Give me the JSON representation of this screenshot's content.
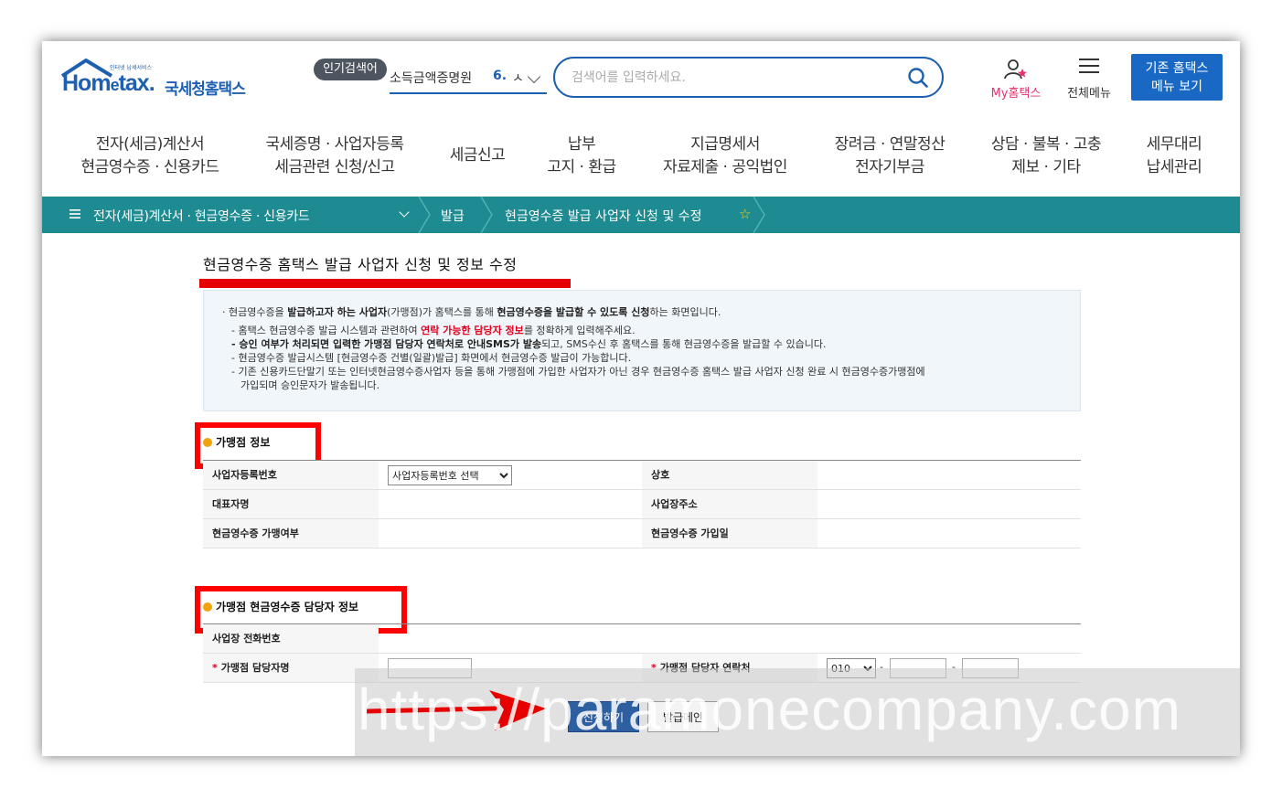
{
  "header": {
    "logo_small": "인터넷 납세서비스",
    "logo_brand": "Hom",
    "logo_brand_e": "e",
    "logo_brand_tail": "tax.",
    "logo_kname": "국세청홈택스",
    "popular_badge": "인기검색어",
    "popular_term": "소득금액증명원",
    "popular_rank": "6.",
    "popular_rank_text": "ㅅ",
    "search_placeholder": "검색어를 입력하세요.",
    "my_label": "My홈택스",
    "allmenu_label": "전체메뉴",
    "oldmenu_line1": "기존 홈택스",
    "oldmenu_line2": "메뉴 보기"
  },
  "gnb": [
    {
      "line1": "전자(세금)계산서",
      "line2": "현금영수증 · 신용카드"
    },
    {
      "line1": "국세증명 · 사업자등록",
      "line2": "세금관련 신청/신고"
    },
    {
      "line1": "세금신고",
      "line2": ""
    },
    {
      "line1": "납부",
      "line2": "고지 · 환급"
    },
    {
      "line1": "지급명세서",
      "line2": "자료제출 · 공익법인"
    },
    {
      "line1": "장려금 · 연말정산",
      "line2": "전자기부금"
    },
    {
      "line1": "상담 · 불복 · 고충",
      "line2": "제보 · 기타"
    },
    {
      "line1": "세무대리",
      "line2": "납세관리"
    }
  ],
  "breadcrumb": {
    "level1": "전자(세금)계산서 · 현금영수증 · 신용카드",
    "level2": "발급",
    "level3": "현금영수증 발급 사업자 신청 및 수정"
  },
  "page": {
    "title": "현금영수증 홈택스 발급 사업자 신청 및 정보 수정",
    "notice": {
      "l1_a": "현금영수증을 ",
      "l1_b": "발급하고자 하는 사업자",
      "l1_c": "(가맹점)가 홈택스를 통해 ",
      "l1_d": "현금영수증을 발급할 수 있도록 신청",
      "l1_e": "하는 화면입니다.",
      "l2_a": "- 홈택스 현금영수증 발급 시스템과 관련하여 ",
      "l2_b": "연락 가능한 담당자 정보",
      "l2_c": "를 정확하게 입력해주세요.",
      "l3_a": "- 승인 여부가 처리되면 입력한 가맹점 담당자 연락처로 안내SMS가 발송",
      "l3_b": "되고, SMS수신 후 홈택스를 통해 현금영수증을 발급할 수 있습니다.",
      "l4": "- 현금영수증 발급시스템 [현금영수증 건별(일괄)발급] 화면에서 현금영수증 발급이 가능합니다.",
      "l5": "- 기존 신용카드단말기 또는 인터넷현금영수증사업자 등을 통해 가맹점에 가입한 사업자가 아닌 경우 현금영수증 홈택스 발급 사업자 신청 완료 시 현금영수증가맹점에",
      "l6": "가입되며 승인문자가 발송됩니다."
    },
    "section1_title": "가맹점 정보",
    "section1": {
      "bizno_label": "사업자등록번호",
      "bizno_select": "사업자등록번호 선택",
      "company_label": "상호",
      "ceo_label": "대표자명",
      "addr_label": "사업장주소",
      "member_label": "현금영수증 가맹여부",
      "joindate_label": "현금영수증 가입일"
    },
    "section2_title": "가맹점 현금영수증 담당자 정보",
    "section2": {
      "phone_label": "사업장 전화번호",
      "mgr_name_label": "가맹점 담당자명",
      "mgr_phone_label": "가맹점 담당자 연락처",
      "mgr_phone_prefix": "010",
      "dash": "-",
      "required_mark": "*"
    },
    "apply_button": "신청하기",
    "main_button": "발급메인"
  },
  "watermark": "https://paramonecompany.com",
  "colors": {
    "brand_blue": "#1d5fb0",
    "breadcrumb_teal": "#1d8b91",
    "annotation_red": "#ff0000",
    "highlight_red": "#e1001e"
  }
}
